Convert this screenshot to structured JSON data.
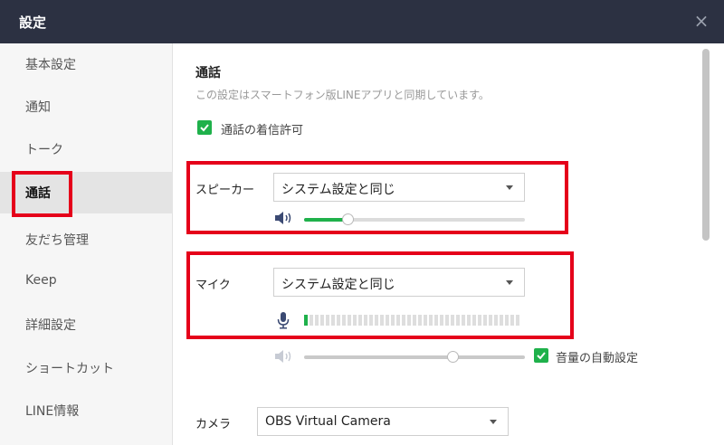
{
  "window": {
    "title": "設定",
    "close_glyph": "×"
  },
  "sidebar": {
    "items": [
      {
        "label": "基本設定"
      },
      {
        "label": "通知"
      },
      {
        "label": "トーク"
      },
      {
        "label": "通話",
        "active": true
      },
      {
        "label": "友だち管理"
      },
      {
        "label": "Keep"
      },
      {
        "label": "詳細設定"
      },
      {
        "label": "ショートカット"
      },
      {
        "label": "LINE情報"
      }
    ]
  },
  "call": {
    "title": "通話",
    "description": "この設定はスマートフォン版LINEアプリと同期しています。",
    "allow_incoming": {
      "label": "通話の着信許可",
      "checked": true
    },
    "speaker": {
      "label": "スピーカー",
      "device": "システム設定と同じ",
      "volume": 0.2
    },
    "mic": {
      "label": "マイク",
      "device": "システム設定と同じ",
      "level_segments_total": 40,
      "level_segments_on": 1,
      "volume": 0.67
    },
    "auto_volume": {
      "label": "音量の自動設定",
      "checked": true
    },
    "camera": {
      "label": "カメラ",
      "device": "OBS Virtual Camera"
    }
  },
  "colors": {
    "accent": "#1fb14b",
    "highlight": "#e5001a",
    "titlebar": "#2c3142"
  },
  "icons": [
    "close-icon",
    "speaker-icon",
    "mic-icon",
    "check-icon",
    "chevron-down-icon"
  ]
}
